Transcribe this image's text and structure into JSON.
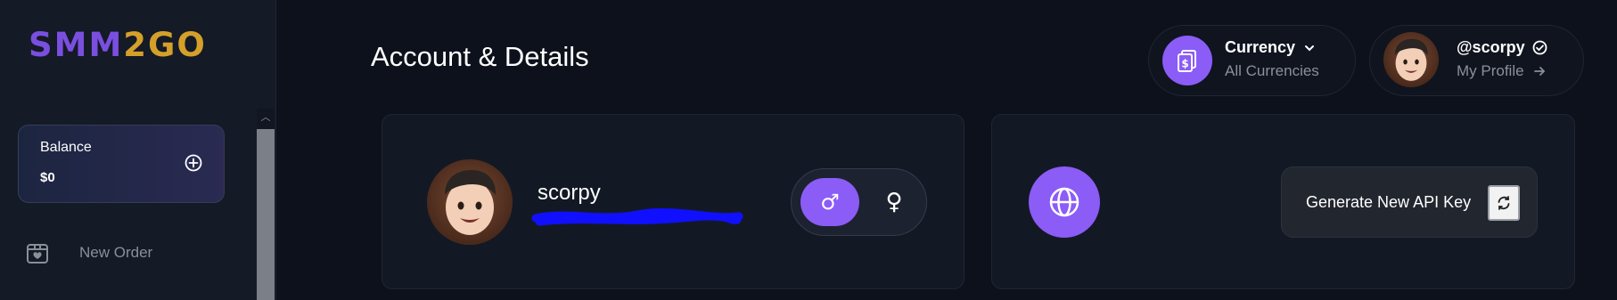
{
  "brand": {
    "logo_part1": "SMM",
    "logo_part2": "2GO"
  },
  "sidebar": {
    "balance": {
      "label": "Balance",
      "value": "$0",
      "add_icon": "plus-circle-icon"
    },
    "items": [
      {
        "label": "New Order",
        "icon": "gift-box-icon"
      }
    ]
  },
  "header": {
    "title": "Account & Details",
    "currency": {
      "title": "Currency",
      "subtitle": "All Currencies",
      "icon": "currency-icon",
      "chevron_icon": "chevron-down-icon"
    },
    "profile": {
      "username": "@scorpy",
      "link": "My Profile",
      "verified_icon": "check-circle-icon",
      "arrow_icon": "arrow-right-icon"
    }
  },
  "account_card": {
    "username": "scorpy",
    "gender_options": [
      {
        "symbol": "♂",
        "name": "male",
        "selected": true
      },
      {
        "symbol": "♀",
        "name": "female",
        "selected": false
      }
    ]
  },
  "api_card": {
    "globe_icon": "globe-icon",
    "generate_label": "Generate New API Key",
    "refresh_icon": "refresh-icon"
  },
  "colors": {
    "accent": "#8b5cf6",
    "background": "#0d111b",
    "card": "#131924",
    "muted_text": "#8a8f99",
    "logo_purple": "#7a4fe0",
    "logo_gold": "#d4a02a"
  }
}
